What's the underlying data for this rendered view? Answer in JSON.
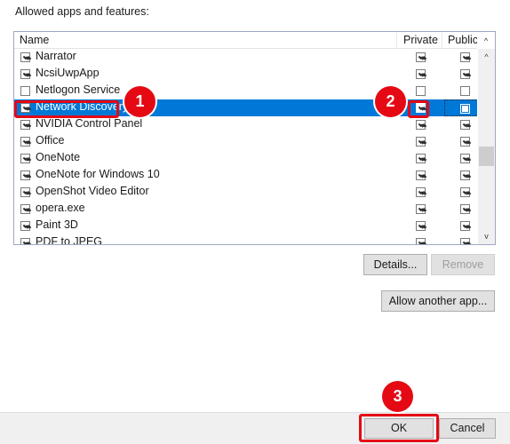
{
  "dialog": {
    "label": "Allowed apps and features:"
  },
  "list": {
    "columns": {
      "name": "Name",
      "private": "Private",
      "public": "Public"
    },
    "rows": [
      {
        "name": "Narrator",
        "allowed": true,
        "private": true,
        "public": true,
        "selected": false
      },
      {
        "name": "NcsiUwpApp",
        "allowed": true,
        "private": true,
        "public": true,
        "selected": false
      },
      {
        "name": "Netlogon Service",
        "allowed": false,
        "private": false,
        "public": false,
        "selected": false
      },
      {
        "name": "Network Discovery",
        "allowed": true,
        "private": true,
        "public": false,
        "selected": true
      },
      {
        "name": "NVIDIA Control Panel",
        "allowed": true,
        "private": true,
        "public": true,
        "selected": false
      },
      {
        "name": "Office",
        "allowed": true,
        "private": true,
        "public": true,
        "selected": false
      },
      {
        "name": "OneNote",
        "allowed": true,
        "private": true,
        "public": true,
        "selected": false
      },
      {
        "name": "OneNote for Windows 10",
        "allowed": true,
        "private": true,
        "public": true,
        "selected": false
      },
      {
        "name": "OpenShot Video Editor",
        "allowed": true,
        "private": true,
        "public": true,
        "selected": false
      },
      {
        "name": "opera.exe",
        "allowed": true,
        "private": true,
        "public": true,
        "selected": false
      },
      {
        "name": "Paint 3D",
        "allowed": true,
        "private": true,
        "public": true,
        "selected": false
      },
      {
        "name": "PDF to JPEG",
        "allowed": true,
        "private": true,
        "public": true,
        "selected": false
      }
    ],
    "scroll_up_icon": "chevron-up-icon",
    "scroll_down_icon": "chevron-down-icon",
    "header_sort_icon": "chevron-up-icon"
  },
  "buttons": {
    "details": "Details...",
    "remove": "Remove",
    "allow_another": "Allow another app...",
    "ok": "OK",
    "cancel": "Cancel"
  },
  "annotations": {
    "badge_1": "1",
    "badge_2": "2",
    "badge_3": "3"
  },
  "colors": {
    "selection_blue": "#0078D7",
    "annotation_red": "#E50914",
    "dialog_face": "#F0F0F0",
    "button_face": "#E1E1E1"
  }
}
